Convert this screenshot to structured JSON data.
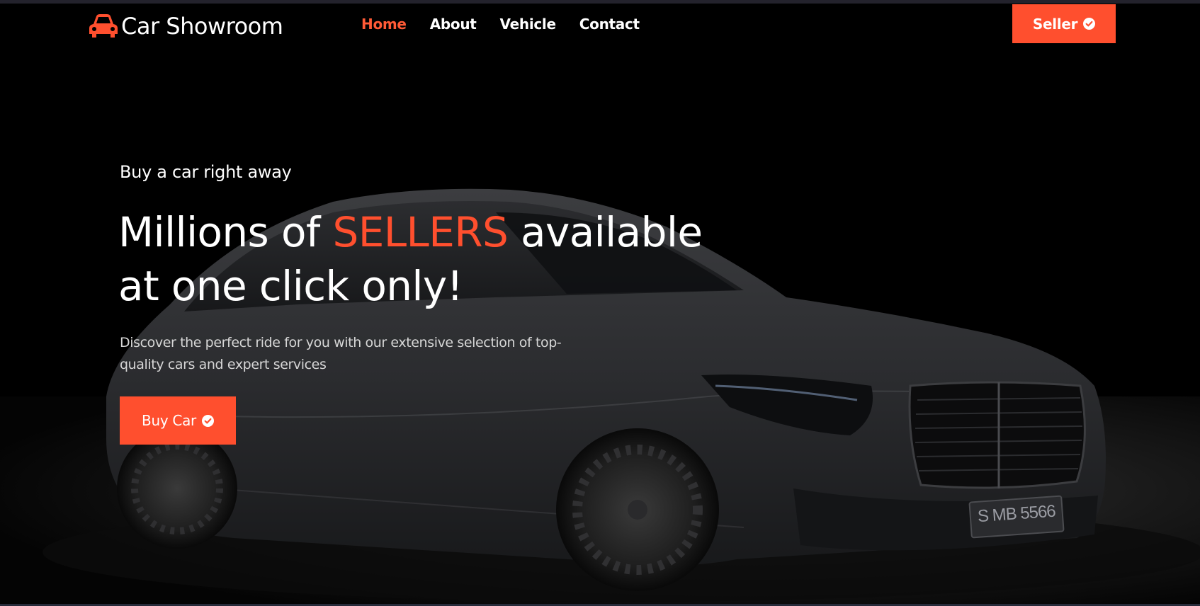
{
  "brand": {
    "name": "Car Showroom",
    "icon": "car-icon",
    "accent_color": "#ff4f2e"
  },
  "nav": {
    "items": [
      {
        "label": "Home",
        "active": true
      },
      {
        "label": "About",
        "active": false
      },
      {
        "label": "Vehicle",
        "active": false
      },
      {
        "label": "Contact",
        "active": false
      }
    ],
    "seller_button": {
      "label": "Seller",
      "icon": "check-circle-icon"
    }
  },
  "hero": {
    "tagline": "Buy a car right away",
    "headline_part1": "Millions of ",
    "headline_accent": "SELLERS",
    "headline_part2": " available at one click only!",
    "description": "Discover the perfect ride for you with our extensive selection of top-quality cars and expert services",
    "cta": {
      "label": "Buy Car",
      "icon": "check-circle-icon"
    },
    "license_plate": "S MB 5566"
  }
}
